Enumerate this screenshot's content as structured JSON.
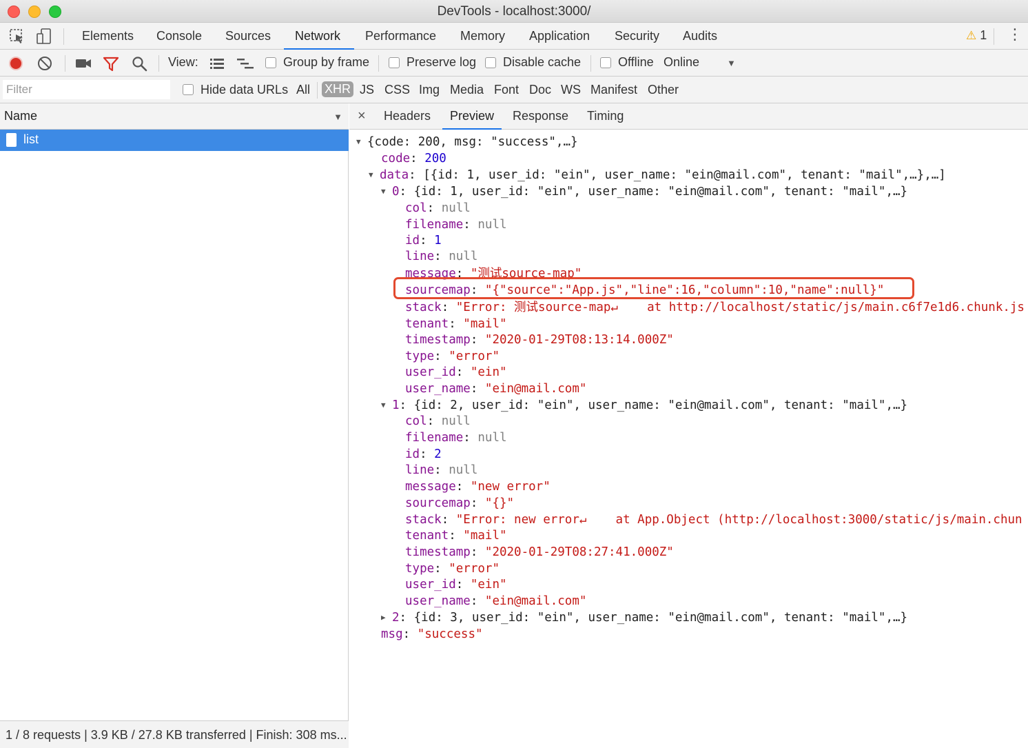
{
  "window": {
    "title": "DevTools - localhost:3000/"
  },
  "main_tabs": [
    "Elements",
    "Console",
    "Sources",
    "Network",
    "Performance",
    "Memory",
    "Application",
    "Security",
    "Audits"
  ],
  "warning_count": "1",
  "toolbar": {
    "view_label": "View:",
    "group_by_frame": "Group by frame",
    "preserve_log": "Preserve log",
    "disable_cache": "Disable cache",
    "offline": "Offline",
    "online": "Online"
  },
  "filter": {
    "placeholder": "Filter",
    "hide_data_urls": "Hide data URLs",
    "types": [
      "All",
      "XHR",
      "JS",
      "CSS",
      "Img",
      "Media",
      "Font",
      "Doc",
      "WS",
      "Manifest",
      "Other"
    ]
  },
  "requests": {
    "column_header": "Name",
    "items": [
      "list"
    ],
    "status": "1 / 8 requests | 3.9 KB / 27.8 KB transferred | Finish: 308 ms..."
  },
  "detail_tabs": [
    "Headers",
    "Preview",
    "Response",
    "Timing"
  ],
  "preview": {
    "root_summary": "{code: 200, msg: \"success\",…}",
    "code": "200",
    "data_summary": "[{id: 1, user_id: \"ein\", user_name: \"ein@mail.com\", tenant: \"mail\",…},…]",
    "items": [
      {
        "index": "0",
        "summary": "{id: 1, user_id: \"ein\", user_name: \"ein@mail.com\", tenant: \"mail\",…}",
        "col": "null",
        "filename": "null",
        "id": "1",
        "line": "null",
        "message": "\"测试source-map\"",
        "sourcemap": "\"{\"source\":\"App.js\",\"line\":16,\"column\":10,\"name\":null}\"",
        "stack": "\"Error: 测试source-map↵    at http://localhost/static/js/main.c6f7e1d6.chunk.js",
        "tenant": "\"mail\"",
        "timestamp": "\"2020-01-29T08:13:14.000Z\"",
        "type": "\"error\"",
        "user_id": "\"ein\"",
        "user_name": "\"ein@mail.com\""
      },
      {
        "index": "1",
        "summary": "{id: 2, user_id: \"ein\", user_name: \"ein@mail.com\", tenant: \"mail\",…}",
        "col": "null",
        "filename": "null",
        "id": "2",
        "line": "null",
        "message": "\"new error\"",
        "sourcemap": "\"{}\"",
        "stack": "\"Error: new error↵    at App.Object (http://localhost:3000/static/js/main.chun",
        "tenant": "\"mail\"",
        "timestamp": "\"2020-01-29T08:27:41.000Z\"",
        "type": "\"error\"",
        "user_id": "\"ein\"",
        "user_name": "\"ein@mail.com\""
      },
      {
        "index": "2",
        "summary": "{id: 3, user_id: \"ein\", user_name: \"ein@mail.com\", tenant: \"mail\",…}"
      }
    ],
    "msg": "\"success\""
  },
  "colors": {
    "key": "#881391",
    "string": "#c41a16",
    "number": "#1c00cf",
    "null": "#808080",
    "selection": "#3d8ae5",
    "highlight_box": "#e34a2f",
    "record": "#d93025"
  }
}
